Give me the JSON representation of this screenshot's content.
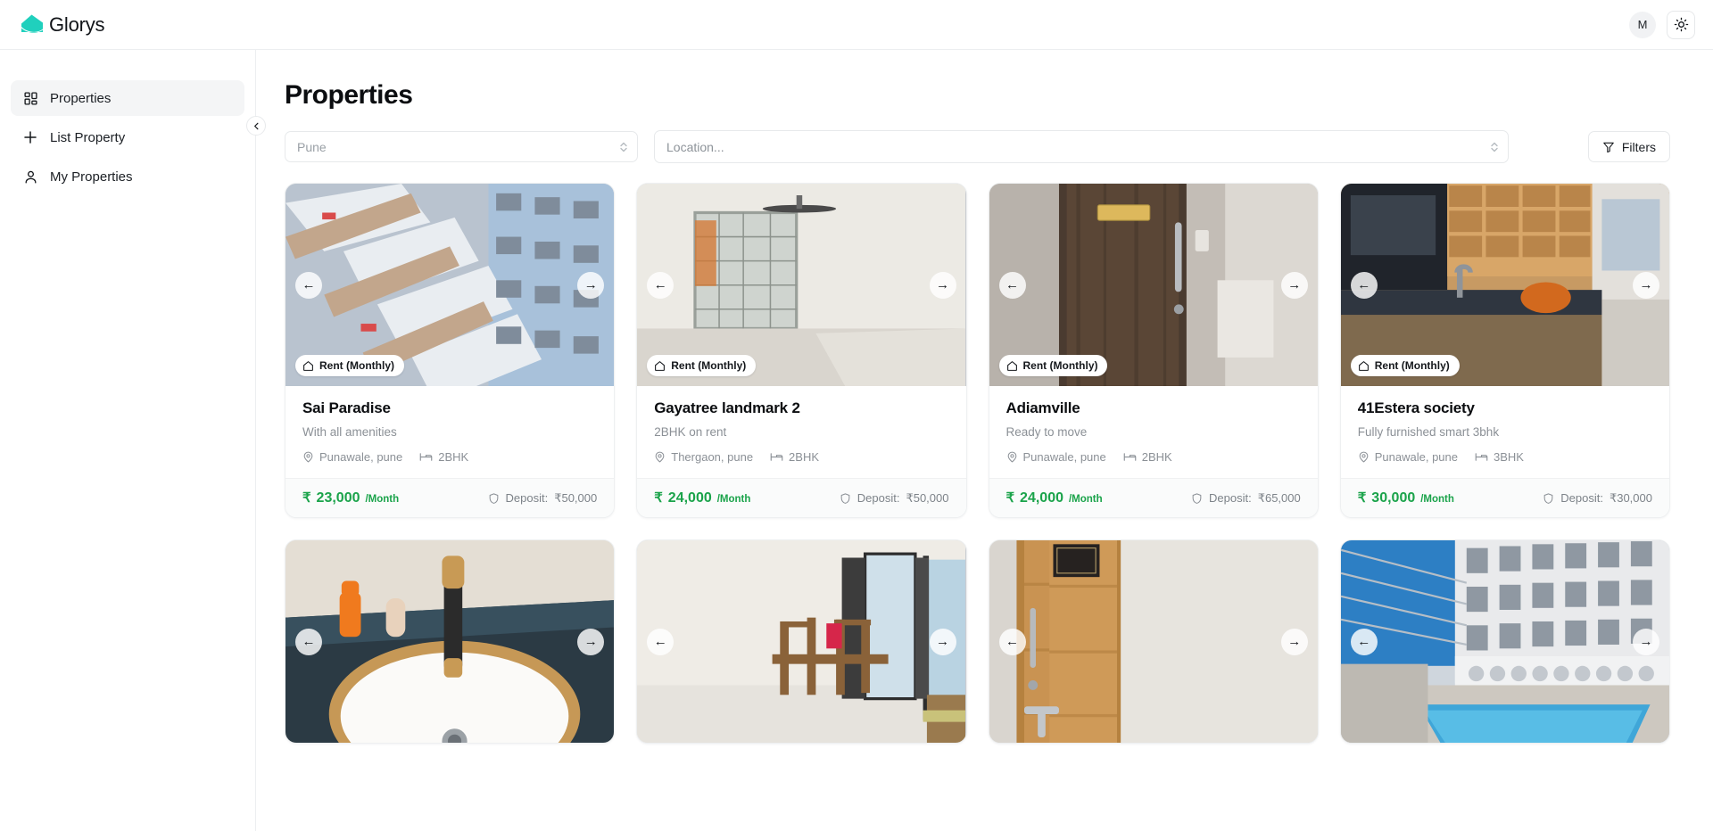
{
  "brand": {
    "name": "Glorys",
    "logo_icon": "house-logo-icon",
    "accent": "#20d0bd"
  },
  "topbar": {
    "avatar_initial": "M",
    "theme_toggle_icon": "sun-icon"
  },
  "sidebar": {
    "collapse_icon": "chevron-left-icon",
    "items": [
      {
        "label": "Properties",
        "icon": "grid-icon",
        "active": true
      },
      {
        "label": "List Property",
        "icon": "plus-icon",
        "active": false
      },
      {
        "label": "My Properties",
        "icon": "user-icon",
        "active": false
      }
    ]
  },
  "main": {
    "title": "Properties",
    "filters": {
      "city_value": "Pune",
      "location_placeholder": "Location...",
      "filters_label": "Filters",
      "filters_icon": "funnel-icon",
      "caret_icon": "chevron-updown-icon"
    },
    "badge_label": "Rent (Monthly)",
    "badge_icon": "home-icon",
    "arrow_prev_icon": "arrow-left-icon",
    "arrow_next_icon": "arrow-right-icon",
    "arrow_prev_glyph": "←",
    "arrow_next_glyph": "→",
    "rupee_symbol": "₹",
    "per_month_label": "/Month",
    "deposit_prefix": "Deposit:",
    "location_icon": "map-pin-icon",
    "bed_icon": "bed-icon",
    "shield_icon": "shield-icon",
    "price_color": "#1aa34a",
    "cards": [
      {
        "title": "Sai Paradise",
        "subtitle": "With all amenities",
        "location": "Punawale, pune",
        "bhk": "2BHK",
        "price": "23,000",
        "deposit": "₹50,000",
        "photo": "apartment-tower-exterior"
      },
      {
        "title": "Gayatree landmark 2",
        "subtitle": "2BHK on rent",
        "location": "Thergaon, pune",
        "bhk": "2BHK",
        "price": "24,000",
        "deposit": "₹50,000",
        "photo": "empty-living-room-window"
      },
      {
        "title": "Adiamville",
        "subtitle": "Ready to move",
        "location": "Punawale, pune",
        "bhk": "2BHK",
        "price": "24,000",
        "deposit": "₹65,000",
        "photo": "dark-wooden-entrance-door"
      },
      {
        "title": "41Estera society",
        "subtitle": "Fully furnished smart 3bhk",
        "location": "Punawale, pune",
        "bhk": "3BHK",
        "price": "30,000",
        "deposit": "₹30,000",
        "photo": "modular-kitchen-counter"
      }
    ],
    "cards_row2": [
      {
        "photo": "bathroom-sink-basin"
      },
      {
        "photo": "dining-room-table-chairs"
      },
      {
        "photo": "wooden-door-nameplate"
      },
      {
        "photo": "apartment-pool-exterior"
      }
    ]
  }
}
